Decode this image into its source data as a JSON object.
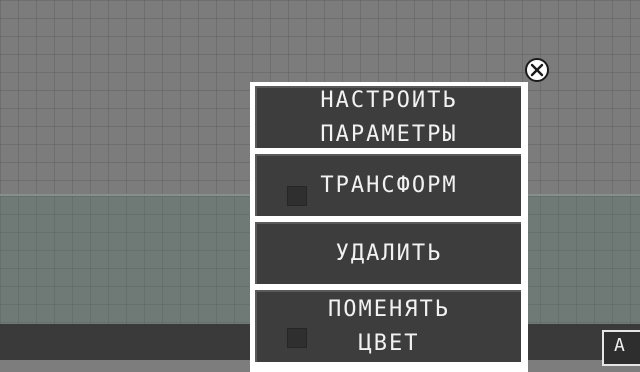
{
  "menu": {
    "items": [
      {
        "lines": [
          "НАСТРОИТЬ",
          "ПАРАМЕТРЫ"
        ]
      },
      {
        "lines": [
          "ТРАНСФОРМ"
        ]
      },
      {
        "lines": [
          "УДАЛИТЬ"
        ]
      },
      {
        "lines": [
          "ПОМЕНЯТЬ",
          "ЦВЕТ"
        ]
      }
    ],
    "close_icon": "close-circle-icon"
  },
  "bottom_bar": {
    "corner_button_label": "A"
  },
  "colors": {
    "menu_frame": "#ffffff",
    "menu_item_bg": "#3d3d3d",
    "menu_text": "#f2f2f2",
    "background_grid": "#7c7c7c",
    "ground": "#6f7a76",
    "bottom_bar": "#3a3a3a"
  }
}
